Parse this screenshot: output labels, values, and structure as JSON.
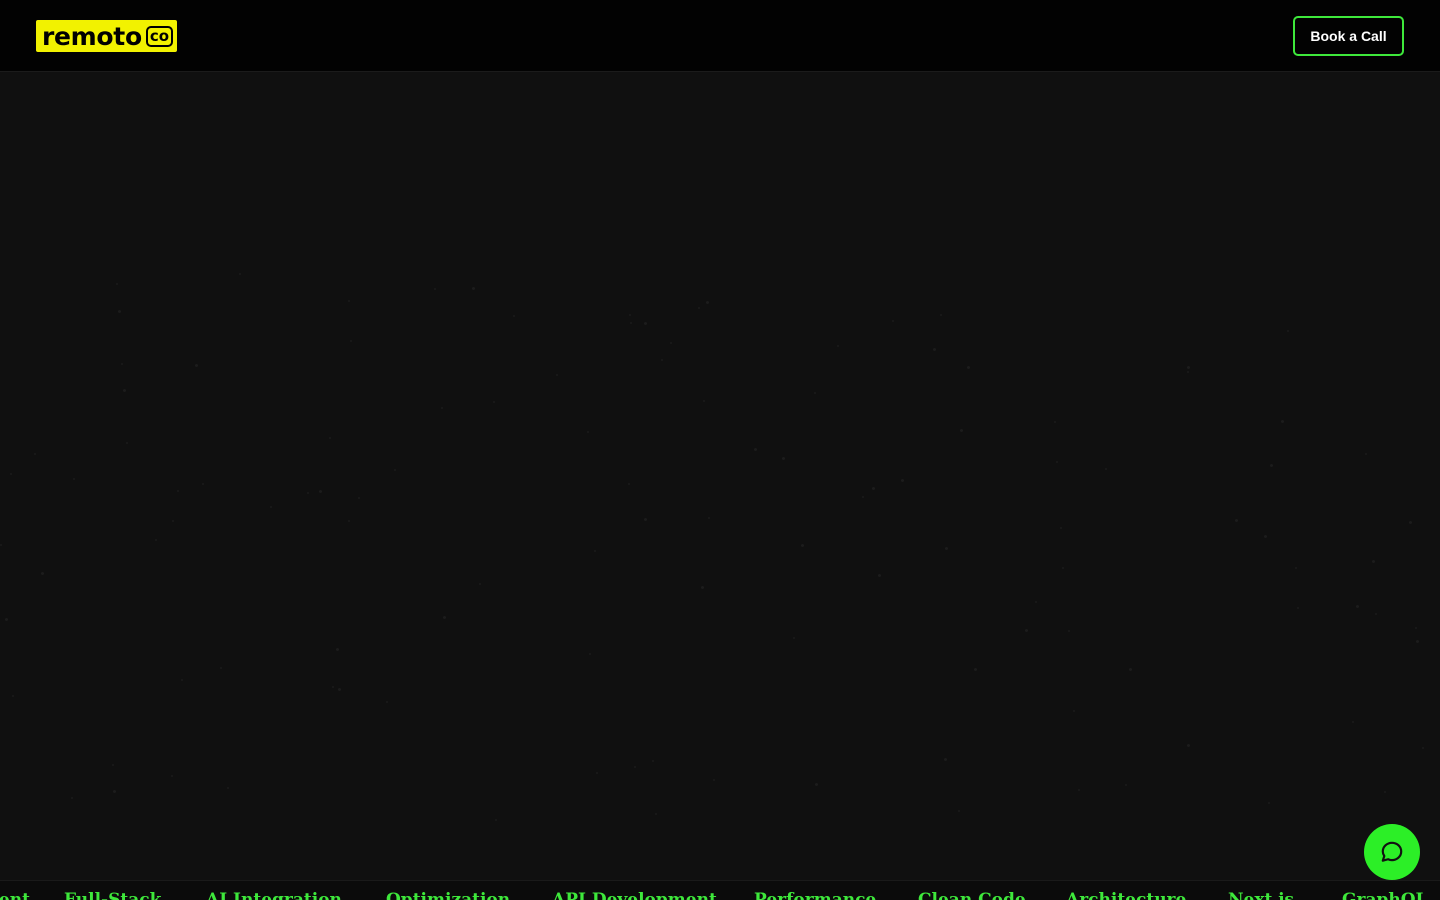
{
  "header": {
    "logo_text": "remoto",
    "logo_badge": "co",
    "cta_label": "Book a Call"
  },
  "ticker": {
    "items": [
      "Development",
      "Full-Stack",
      "AI Integration",
      "Optimization",
      "API Development",
      "Performance",
      "Clean Code",
      "Architecture",
      "Next.js",
      "GraphQL"
    ]
  },
  "chat": {
    "icon": "chat-bubble-icon"
  },
  "colors": {
    "accent_green": "#3ee83b",
    "logo_yellow": "#f2f200",
    "background": "#101010",
    "header_bg": "#020202"
  }
}
